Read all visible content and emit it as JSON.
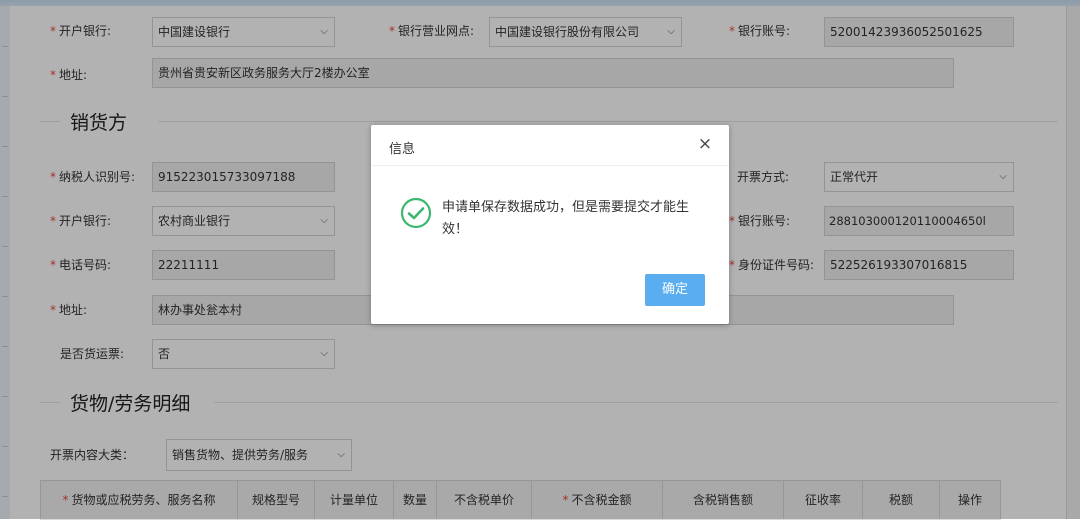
{
  "buyer": {
    "bank_label": "开户银行:",
    "bank_value": "中国建设银行",
    "branch_label": "银行营业网点:",
    "branch_value": "中国建设银行股份有限公司",
    "account_label": "银行账号:",
    "account_value": "52001423936052501625",
    "address_label": "地址:",
    "address_value": "贵州省贵安新区政务服务大厅2楼办公室"
  },
  "seller": {
    "section_title": "销货方",
    "taxid_label": "纳税人识别号:",
    "taxid_value": "915223015733097188",
    "invoice_mode_label": "开票方式:",
    "invoice_mode_value": "正常代开",
    "bank_label": "开户银行:",
    "bank_value": "农村商业银行",
    "account_label": "银行账号:",
    "account_value": "288103000120110004650l",
    "phone_label": "电话号码:",
    "phone_value": "22211111",
    "idcard_label": "身份证件号码:",
    "idcard_value": "522526193307016815",
    "address_label": "地址:",
    "address_value": "林办事处瓮本村",
    "freight_label": "是否货运票:",
    "freight_value": "否"
  },
  "goods": {
    "section_title": "货物/劳务明细",
    "category_label": "开票内容大类：",
    "category_value": "销售货物、提供劳务/服务",
    "columns": [
      "货物或应税劳务、服务名称",
      "规格型号",
      "计量单位",
      "数量",
      "不含税单价",
      "不含税金额",
      "含税销售额",
      "征收率",
      "税额",
      "操作"
    ]
  },
  "required_mark": "*",
  "dialog": {
    "title": "信息",
    "close": "×",
    "message": "申请单保存数据成功，但是需要提交才能生效！",
    "ok_label": "确定"
  },
  "colors": {
    "accent": "#5aaef0",
    "success": "#3db86e",
    "required": "#e74c3c"
  }
}
